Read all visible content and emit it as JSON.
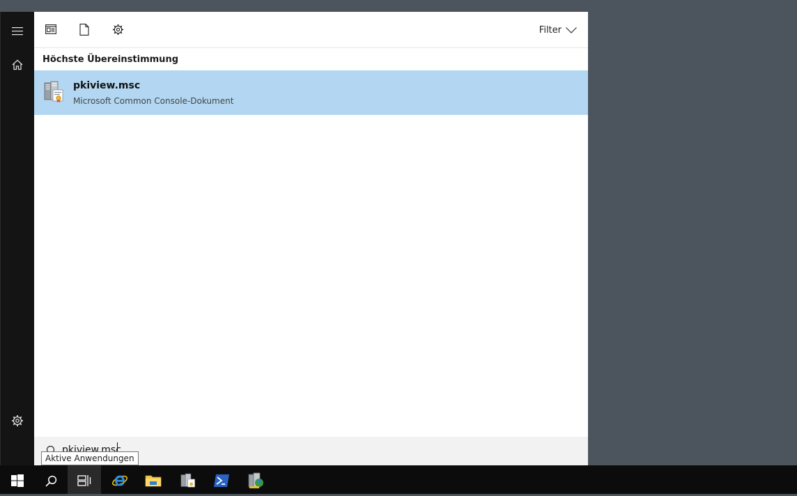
{
  "start_menu": {
    "toolbar": {
      "filter_label": "Filter",
      "icons": [
        "apps-icon",
        "document-icon",
        "settings-icon"
      ]
    },
    "section_title": "Höchste Übereinstimmung",
    "best_match": {
      "name": "pkiview.msc",
      "type": "Microsoft Common Console-Dokument",
      "icon": "mmc-snapin-icon"
    },
    "search": {
      "value": "pkiview.msc"
    },
    "rail": {
      "top_icons": [
        "hamburger-menu-icon",
        "home-icon"
      ],
      "bottom_icons": [
        "settings-icon"
      ]
    }
  },
  "tooltip": {
    "text": "Aktive Anwendungen"
  },
  "taskbar": {
    "items": [
      {
        "name": "start",
        "icon": "windows-logo-icon"
      },
      {
        "name": "search",
        "icon": "search-icon"
      },
      {
        "name": "task-view",
        "icon": "task-view-icon",
        "active": true
      },
      {
        "name": "internet-explorer",
        "icon": "internet-explorer-icon"
      },
      {
        "name": "file-explorer",
        "icon": "folder-icon",
        "running": true
      },
      {
        "name": "server-manager",
        "icon": "server-manager-icon",
        "running": true
      },
      {
        "name": "powershell",
        "icon": "powershell-icon",
        "running": true
      },
      {
        "name": "mmc-console",
        "icon": "mmc-console-icon",
        "running": true
      }
    ]
  },
  "colors": {
    "desktop": "#4c545d",
    "rail": "#141414",
    "selection": "#b3d7f2",
    "taskbar": "#0c0c0c",
    "running_indicator": "#76b9ed"
  }
}
